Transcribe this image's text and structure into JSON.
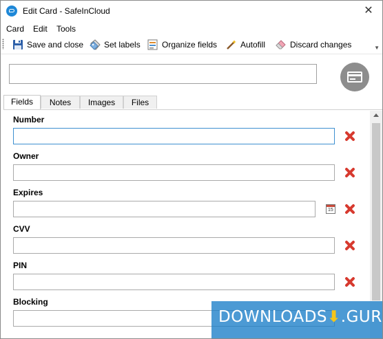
{
  "window": {
    "title": "Edit Card - SafeInCloud",
    "close_glyph": "✕",
    "app_icon": "safeincloud-cloud-icon"
  },
  "menu": [
    {
      "label": "Card"
    },
    {
      "label": "Edit"
    },
    {
      "label": "Tools"
    }
  ],
  "toolbar": {
    "save_label": "Save and close",
    "labels_label": "Set labels",
    "organize_label": "Organize fields",
    "autofill_label": "Autofill",
    "discard_label": "Discard changes"
  },
  "card_name": {
    "value": ""
  },
  "tabs": [
    {
      "label": "Fields",
      "active": true
    },
    {
      "label": "Notes",
      "active": false
    },
    {
      "label": "Images",
      "active": false
    },
    {
      "label": "Files",
      "active": false
    }
  ],
  "fields": [
    {
      "label": "Number",
      "value": ""
    },
    {
      "label": "Owner",
      "value": ""
    },
    {
      "label": "Expires",
      "value": ""
    },
    {
      "label": "CVV",
      "value": ""
    },
    {
      "label": "PIN",
      "value": ""
    },
    {
      "label": "Blocking",
      "value": ""
    }
  ],
  "calendar_icon_text": "15",
  "watermark": {
    "text_left": "DOWNLOADS",
    "arrow": "⬇",
    "text_right": ".GURU"
  },
  "colors": {
    "delete": "#d73a2f",
    "focus_border": "#3c8fd0",
    "watermark_bg": "#1f7dc8"
  }
}
